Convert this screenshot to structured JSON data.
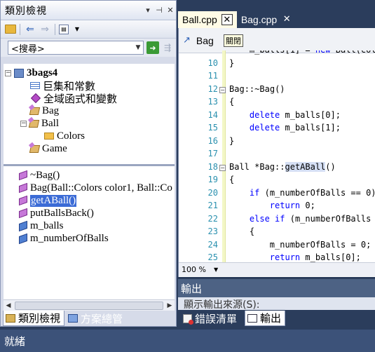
{
  "class_view": {
    "title": "類別檢視",
    "pin_icon": "▾",
    "search_value": "<搜尋>",
    "tree": [
      {
        "label": "3bags4",
        "icon": "project-icon"
      },
      {
        "label": "巨集和常數",
        "icon": "macro-icon"
      },
      {
        "label": "全域函式和變數",
        "icon": "global-function-icon"
      },
      {
        "label": "Bag",
        "icon": "class-icon"
      },
      {
        "label": "Ball",
        "icon": "class-icon"
      },
      {
        "label": "Colors",
        "icon": "enum-icon"
      },
      {
        "label": "Game",
        "icon": "class-icon"
      }
    ],
    "members": [
      {
        "label": "~Bag()",
        "icon": "method-icon"
      },
      {
        "label": "Bag(Ball::Colors color1, Ball::Co",
        "icon": "method-icon"
      },
      {
        "label": "getABall()",
        "icon": "method-icon",
        "selected": true
      },
      {
        "label": "putBallsBack()",
        "icon": "method-icon"
      },
      {
        "label": "m_balls",
        "icon": "field-icon"
      },
      {
        "label": "m_numberOfBalls",
        "icon": "field-icon"
      }
    ],
    "tabs": [
      {
        "label": "類別檢視",
        "active": true
      },
      {
        "label": "方案總管",
        "active": false
      }
    ]
  },
  "editor": {
    "tabs": [
      {
        "label": "Ball.cpp",
        "active": true
      },
      {
        "label": "Bag.cpp",
        "active": false
      }
    ],
    "close_symbol": "✕",
    "nav_label": "Bag",
    "tooltip": "關閉",
    "zoom": "100 %",
    "lines": [
      {
        "n": "",
        "code": "    m_balls[1] = new Ball(colo"
      },
      {
        "n": "10",
        "code": "}"
      },
      {
        "n": "11",
        "code": ""
      },
      {
        "n": "12",
        "code": "Bag::~Bag()"
      },
      {
        "n": "13",
        "code": "{"
      },
      {
        "n": "14",
        "code": "    delete m_balls[0];"
      },
      {
        "n": "15",
        "code": "    delete m_balls[1];"
      },
      {
        "n": "16",
        "code": "}"
      },
      {
        "n": "17",
        "code": ""
      },
      {
        "n": "18",
        "code": "Ball *Bag::getABall()"
      },
      {
        "n": "19",
        "code": "{"
      },
      {
        "n": "20",
        "code": "    if (m_numberOfBalls == 0)"
      },
      {
        "n": "21",
        "code": "        return 0;"
      },
      {
        "n": "22",
        "code": "    else if (m_numberOfBalls"
      },
      {
        "n": "23",
        "code": "    {"
      },
      {
        "n": "24",
        "code": "        m_numberOfBalls = 0;"
      },
      {
        "n": "25",
        "code": "        return m_balls[0];"
      },
      {
        "n": "26",
        "code": "    }"
      }
    ]
  },
  "output": {
    "title": "輸出",
    "source_label": "顯示輸出來源(S):",
    "tabs": [
      {
        "label": "錯誤清單",
        "active": false
      },
      {
        "label": "輸出",
        "active": true
      }
    ]
  },
  "status": {
    "text": "就緒"
  }
}
